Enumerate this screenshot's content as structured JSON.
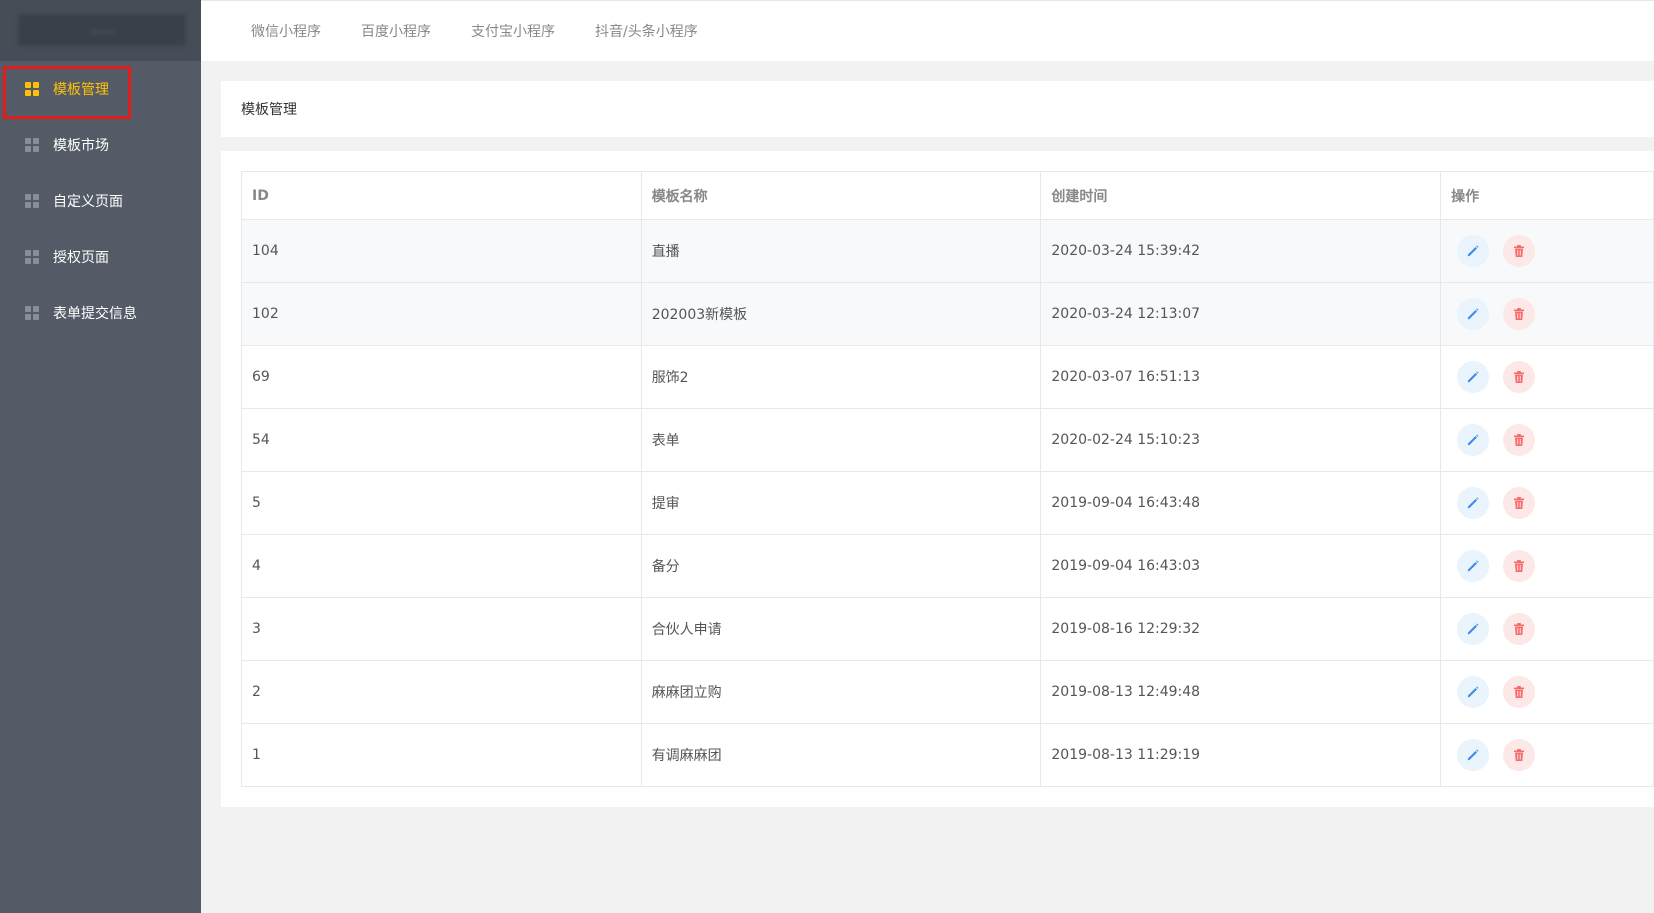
{
  "sidebar": {
    "logo_text": "......",
    "items": [
      {
        "label": "模板管理",
        "active": true
      },
      {
        "label": "模板市场",
        "active": false
      },
      {
        "label": "自定义页面",
        "active": false
      },
      {
        "label": "授权页面",
        "active": false
      },
      {
        "label": "表单提交信息",
        "active": false
      }
    ]
  },
  "topbar": {
    "tabs": [
      "微信小程序",
      "百度小程序",
      "支付宝小程序",
      "抖音/头条小程序"
    ]
  },
  "panel": {
    "title": "模板管理"
  },
  "table": {
    "headers": [
      "ID",
      "模板名称",
      "创建时间",
      "操作"
    ],
    "rows": [
      {
        "id": "104",
        "name": "直播",
        "time": "2020-03-24 15:39:42"
      },
      {
        "id": "102",
        "name": "202003新模板",
        "time": "2020-03-24 12:13:07"
      },
      {
        "id": "69",
        "name": "服饰2",
        "time": "2020-03-07 16:51:13"
      },
      {
        "id": "54",
        "name": "表单",
        "time": "2020-02-24 15:10:23"
      },
      {
        "id": "5",
        "name": "提审",
        "time": "2019-09-04 16:43:48"
      },
      {
        "id": "4",
        "name": "备分",
        "time": "2019-09-04 16:43:03"
      },
      {
        "id": "3",
        "name": "合伙人申请",
        "time": "2019-08-16 12:29:32"
      },
      {
        "id": "2",
        "name": "麻麻团立购",
        "time": "2019-08-13 12:49:48"
      },
      {
        "id": "1",
        "name": "有调麻麻团",
        "time": "2019-08-13 11:29:19"
      }
    ]
  },
  "colors": {
    "sidebar_bg": "#545b66",
    "active": "#ffc107",
    "edit": "#3a8ee6",
    "delete": "#f56c6c",
    "highlight": "#e31b1b"
  },
  "icons": {
    "nav": "grid-icon",
    "edit": "pencil-icon",
    "delete": "trash-icon"
  }
}
